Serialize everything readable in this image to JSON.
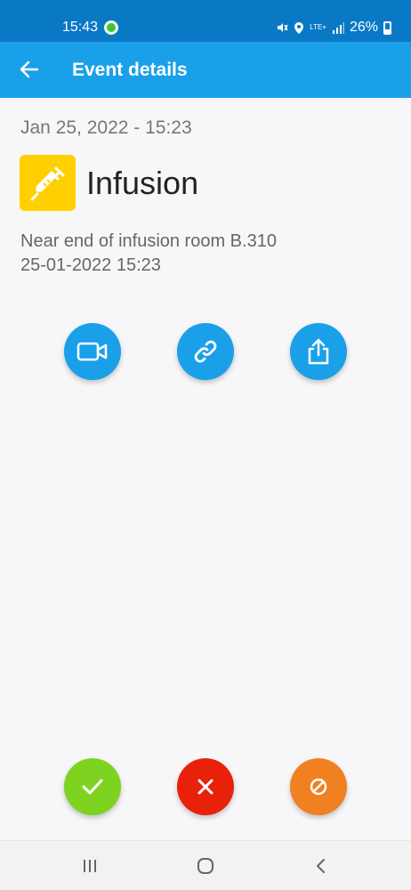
{
  "status_bar": {
    "time": "15:43",
    "network": "LTE+",
    "battery": "26%",
    "icons": [
      "chat-notification-icon",
      "mute-icon",
      "location-icon",
      "lte-icon",
      "signal-icon",
      "battery-icon"
    ]
  },
  "app_bar": {
    "title": "Event details",
    "back_icon": "arrow-back-icon"
  },
  "event": {
    "date": "Jan 25, 2022 - 15:23",
    "type": "Infusion",
    "type_icon": "syringe-icon",
    "description_line1": "Near end of infusion room B.310",
    "description_line2": "25-01-2022 15:23"
  },
  "actions": [
    {
      "icon": "video-camera-icon"
    },
    {
      "icon": "link-icon"
    },
    {
      "icon": "share-icon"
    }
  ],
  "responses": [
    {
      "icon": "check-icon"
    },
    {
      "icon": "close-icon"
    },
    {
      "icon": "block-icon"
    }
  ],
  "colors": {
    "status_bar": "#0a79c5",
    "app_bar": "#1aa0e8",
    "type_icon_bg": "#ffd000",
    "accept": "#7ed321",
    "reject": "#e8210a",
    "ignore": "#f08020"
  },
  "nav_bar": {
    "items": [
      "recent-apps-icon",
      "home-icon",
      "back-icon"
    ]
  }
}
